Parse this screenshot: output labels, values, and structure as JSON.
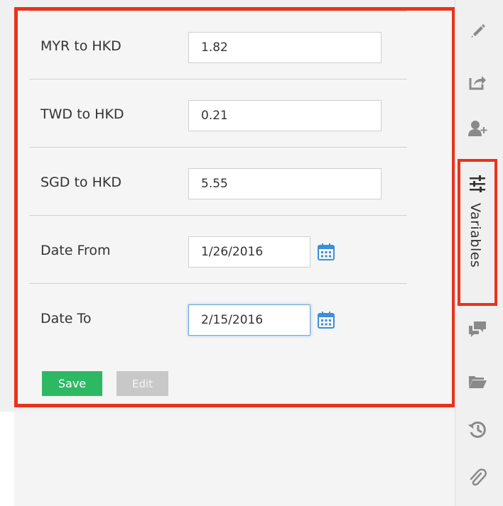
{
  "form": {
    "fields": [
      {
        "label": "MYR to HKD",
        "value": "1.82"
      },
      {
        "label": "TWD to HKD",
        "value": "0.21"
      },
      {
        "label": "SGD to HKD",
        "value": "5.55"
      },
      {
        "label": "Date From",
        "value": "1/26/2016"
      },
      {
        "label": "Date To",
        "value": "2/15/2016"
      }
    ],
    "save_label": "Save",
    "edit_label": "Edit"
  },
  "rail": {
    "variables_label": "Variables",
    "icons": [
      "pencil-icon",
      "share-icon",
      "add-user-icon",
      "sliders-icon",
      "comments-icon",
      "folder-icon",
      "history-icon",
      "paperclip-icon"
    ]
  },
  "colors": {
    "highlight": "#e8331c",
    "save_button": "#2db963",
    "edit_button": "#c8c8c8",
    "calendar_icon": "#3a8fd9"
  }
}
